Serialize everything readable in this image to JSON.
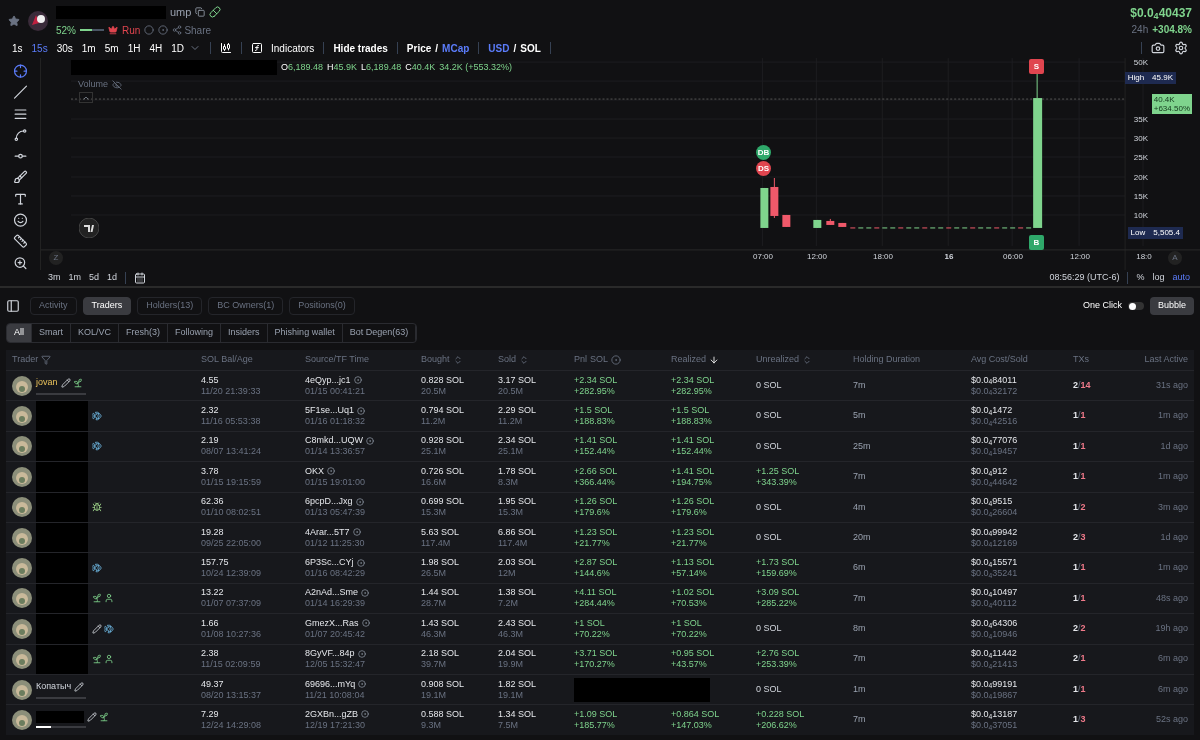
{
  "header": {
    "name_suffix": "ump",
    "progress": {
      "label": "52%",
      "level": 0.52
    },
    "run_label": "Run",
    "share_label": "Share",
    "price": "$0.0$_{4}$40437",
    "change_label": "24h",
    "change": "+304.8%"
  },
  "toolbar": {
    "timeframes": [
      {
        "label": "1s",
        "selected": false
      },
      {
        "label": "15s",
        "selected": true
      },
      {
        "label": "30s",
        "selected": false
      },
      {
        "label": "1m",
        "selected": false
      },
      {
        "label": "5m",
        "selected": false
      },
      {
        "label": "1H",
        "selected": false
      },
      {
        "label": "4H",
        "selected": false
      },
      {
        "label": "1D",
        "selected": false
      }
    ],
    "indicators": "Indicators",
    "hide_trades": "Hide trades",
    "metric": {
      "separator": "/",
      "options": [
        {
          "label": "Price",
          "selected": false
        },
        {
          "label": "MCap",
          "selected": true
        }
      ]
    },
    "currency": {
      "separator": "/",
      "options": [
        {
          "label": "USD",
          "selected": true
        },
        {
          "label": "SOL",
          "selected": false
        }
      ]
    }
  },
  "chart": {
    "ohlc": [
      {
        "label": "O",
        "value": "6,189.48"
      },
      {
        "label": "H",
        "value": "45.9K"
      },
      {
        "label": "L",
        "value": "6,189.48"
      },
      {
        "label": "C",
        "value": "40.4K"
      }
    ],
    "change": "34.2K (+553.32%)",
    "volume_label": "Volume",
    "y_labels": [
      "50K",
      "35K",
      "30K",
      "25K",
      "20K",
      "15K",
      "10K"
    ],
    "high": {
      "label": "High",
      "value": "45.9K"
    },
    "last": {
      "value": "40.4K",
      "change": "+634.50%"
    },
    "low": {
      "label": "Low",
      "value": "5,505.4"
    },
    "x_labels": [
      {
        "label": "07:00",
        "bold": false
      },
      {
        "label": "12:00",
        "bold": false
      },
      {
        "label": "18:00",
        "bold": false
      },
      {
        "label": "16",
        "bold": true
      },
      {
        "label": "06:00",
        "bold": false
      },
      {
        "label": "12:00",
        "bold": false
      },
      {
        "label": "18:0",
        "bold": false
      }
    ],
    "markers": [
      {
        "label": "DB",
        "color": "#2fa86a"
      },
      {
        "label": "DS",
        "color": "#e0454f"
      },
      {
        "label": "S",
        "color": "#e0454f"
      },
      {
        "label": "B",
        "color": "#2fa86a"
      }
    ],
    "left_scale": "Z",
    "right_scale": "A",
    "ranges": [
      "3m",
      "1m",
      "5d",
      "1d"
    ],
    "clock": "08:56:29 (UTC-6)",
    "scale_options": [
      {
        "label": "%",
        "selected": false
      },
      {
        "label": "log",
        "selected": false
      },
      {
        "label": "auto",
        "selected": true
      }
    ]
  },
  "tabs": [
    {
      "label": "Activity",
      "selected": false
    },
    {
      "label": "Traders",
      "selected": true
    },
    {
      "label": "Holders(13)",
      "selected": false
    },
    {
      "label": "BC Owners(1)",
      "selected": false
    },
    {
      "label": "Positions(0)",
      "selected": false
    }
  ],
  "one_click": {
    "label": "One Click",
    "on": false
  },
  "bubble": "Bubble",
  "filters": [
    {
      "label": "All",
      "selected": true
    },
    {
      "label": "Smart",
      "selected": false
    },
    {
      "label": "KOL/VC",
      "selected": false
    },
    {
      "label": "Fresh(3)",
      "selected": false
    },
    {
      "label": "Following",
      "selected": false
    },
    {
      "label": "Insiders",
      "selected": false
    },
    {
      "label": "Phishing wallet",
      "selected": false
    },
    {
      "label": "Bot Degen(63)",
      "selected": false
    }
  ],
  "columns": [
    {
      "label": "Trader",
      "kind": "filter"
    },
    {
      "label": "SOL Bal/Age",
      "kind": "plain"
    },
    {
      "label": "Source/TF Time",
      "kind": "plain"
    },
    {
      "label": "Bought",
      "kind": "sort"
    },
    {
      "label": "Sold",
      "kind": "sort"
    },
    {
      "label": "Pnl",
      "kind": "toggle",
      "unit": "SOL"
    },
    {
      "label": "Realized",
      "kind": "sorted"
    },
    {
      "label": "Unrealized",
      "kind": "sort"
    },
    {
      "label": "Holding Duration",
      "kind": "plain"
    },
    {
      "label": "Avg Cost/Sold",
      "kind": "plain"
    },
    {
      "label": "TXs",
      "kind": "plain"
    },
    {
      "label": "Last Active",
      "kind": "plain"
    }
  ],
  "rows": [
    {
      "kind": "named",
      "name": "jovan",
      "level": 0,
      "badges": [
        {
          "kind": "edit"
        },
        {
          "kind": "sprout"
        }
      ],
      "bal": "4.55",
      "age": "11/20 21:39:33",
      "source": "4eQyp...jc1",
      "tf_time": "01/15 00:41:21",
      "bought": "0.828 SOL",
      "bought_amt": "20.5M",
      "sold": "3.17 SOL",
      "sold_amt": "20.5M",
      "pnl": {
        "kind": "value",
        "sol": "+2.34 SOL",
        "pct": "+282.95%"
      },
      "realized": "+2.34 SOL",
      "realized_pct": "+282.95%",
      "unrealized": {
        "sol": "0 SOL"
      },
      "duration": "7m",
      "avg_cost": "$0.0$_{4}$84011",
      "avg_sold": "$0.0$_{4}$32172",
      "buys": "2",
      "sep": "/",
      "sells": "14",
      "last": "31s ago"
    },
    {
      "kind": "redacted",
      "badges": [
        {
          "kind": "fish"
        }
      ],
      "bal": "2.32",
      "age": "11/16 05:53:38",
      "source": "5F1se...Uq1",
      "tf_time": "01/16 01:18:32",
      "bought": "0.794 SOL",
      "bought_amt": "11.2M",
      "sold": "2.29 SOL",
      "sold_amt": "11.2M",
      "pnl": {
        "kind": "value",
        "sol": "+1.5 SOL",
        "pct": "+188.83%"
      },
      "realized": "+1.5 SOL",
      "realized_pct": "+188.83%",
      "unrealized": {
        "sol": "0 SOL"
      },
      "duration": "5m",
      "avg_cost": "$0.0$_{4}$1472",
      "avg_sold": "$0.0$_{4}$42516",
      "buys": "1",
      "sep": "/",
      "sells": "1",
      "last": "1m ago"
    },
    {
      "kind": "redacted",
      "badges": [
        {
          "kind": "fish"
        }
      ],
      "bal": "2.19",
      "age": "08/07 13:41:24",
      "source": "C8mkd...UQW",
      "tf_time": "01/14 13:36:57",
      "bought": "0.928 SOL",
      "bought_amt": "25.1M",
      "sold": "2.34 SOL",
      "sold_amt": "25.1M",
      "pnl": {
        "kind": "value",
        "sol": "+1.41 SOL",
        "pct": "+152.44%"
      },
      "realized": "+1.41 SOL",
      "realized_pct": "+152.44%",
      "unrealized": {
        "sol": "0 SOL"
      },
      "duration": "25m",
      "avg_cost": "$0.0$_{4}$77076",
      "avg_sold": "$0.0$_{4}$19457",
      "buys": "1",
      "sep": "/",
      "sells": "1",
      "last": "1d ago"
    },
    {
      "kind": "redacted",
      "badges": [],
      "bal": "3.78",
      "age": "01/15 19:15:59",
      "source": "OKX",
      "tf_time": "01/15 19:01:00",
      "bought": "0.726 SOL",
      "bought_amt": "16.6M",
      "sold": "1.78 SOL",
      "sold_amt": "8.3M",
      "pnl": {
        "kind": "value",
        "sol": "+2.66 SOL",
        "pct": "+366.44%"
      },
      "realized": "+1.41 SOL",
      "realized_pct": "+194.75%",
      "unrealized": {
        "sol": "+1.25 SOL",
        "pct": "+343.39%"
      },
      "duration": "7m",
      "avg_cost": "$0.0$_{4}$912",
      "avg_sold": "$0.0$_{4}$44642",
      "buys": "1",
      "sep": "/",
      "sells": "1",
      "last": "1m ago"
    },
    {
      "kind": "redacted",
      "badges": [
        {
          "kind": "bug"
        }
      ],
      "bal": "62.36",
      "age": "01/10 08:02:51",
      "source": "6pcpD...Jxg",
      "tf_time": "01/13 05:47:39",
      "bought": "0.699 SOL",
      "bought_amt": "15.3M",
      "sold": "1.95 SOL",
      "sold_amt": "15.3M",
      "pnl": {
        "kind": "value",
        "sol": "+1.26 SOL",
        "pct": "+179.6%"
      },
      "realized": "+1.26 SOL",
      "realized_pct": "+179.6%",
      "unrealized": {
        "sol": "0 SOL"
      },
      "duration": "4m",
      "avg_cost": "$0.0$_{4}$9515",
      "avg_sold": "$0.0$_{4}$26604",
      "buys": "1",
      "sep": "/",
      "sells": "2",
      "last": "3m ago"
    },
    {
      "kind": "redacted",
      "badges": [],
      "bal": "19.28",
      "age": "09/25 22:05:00",
      "source": "4Arar...5T7",
      "tf_time": "01/12 11:25:30",
      "bought": "5.63 SOL",
      "bought_amt": "117.4M",
      "sold": "6.86 SOL",
      "sold_amt": "117.4M",
      "pnl": {
        "kind": "value",
        "sol": "+1.23 SOL",
        "pct": "+21.77%"
      },
      "realized": "+1.23 SOL",
      "realized_pct": "+21.77%",
      "unrealized": {
        "sol": "0 SOL"
      },
      "duration": "20m",
      "avg_cost": "$0.0$_{4}$99942",
      "avg_sold": "$0.0$_{4}$12169",
      "buys": "2",
      "sep": "/",
      "sells": "3",
      "last": "1d ago"
    },
    {
      "kind": "redacted",
      "badges": [
        {
          "kind": "fish"
        }
      ],
      "bal": "157.75",
      "age": "10/24 12:39:09",
      "source": "6P3Sc...CYj",
      "tf_time": "01/16 08:42:29",
      "bought": "1.98 SOL",
      "bought_amt": "26.5M",
      "sold": "2.03 SOL",
      "sold_amt": "12M",
      "pnl": {
        "kind": "value",
        "sol": "+2.87 SOL",
        "pct": "+144.6%"
      },
      "realized": "+1.13 SOL",
      "realized_pct": "+57.14%",
      "unrealized": {
        "sol": "+1.73 SOL",
        "pct": "+159.69%"
      },
      "duration": "6m",
      "avg_cost": "$0.0$_{4}$15571",
      "avg_sold": "$0.0$_{4}$35241",
      "buys": "1",
      "sep": "/",
      "sells": "1",
      "last": "1m ago"
    },
    {
      "kind": "redacted",
      "badges": [
        {
          "kind": "sprout"
        },
        {
          "kind": "user"
        }
      ],
      "bal": "13.22",
      "age": "01/07 07:37:09",
      "source": "A2nAd...Sme",
      "tf_time": "01/14 16:29:39",
      "bought": "1.44 SOL",
      "bought_amt": "28.7M",
      "sold": "1.38 SOL",
      "sold_amt": "7.2M",
      "pnl": {
        "kind": "value",
        "sol": "+4.11 SOL",
        "pct": "+284.44%"
      },
      "realized": "+1.02 SOL",
      "realized_pct": "+70.53%",
      "unrealized": {
        "sol": "+3.09 SOL",
        "pct": "+285.22%"
      },
      "duration": "7m",
      "avg_cost": "$0.0$_{4}$10497",
      "avg_sold": "$0.0$_{4}$40112",
      "buys": "1",
      "sep": "/",
      "sells": "1",
      "last": "48s ago"
    },
    {
      "kind": "redacted",
      "badges": [
        {
          "kind": "edit"
        },
        {
          "kind": "fish"
        }
      ],
      "bal": "1.66",
      "age": "01/08 10:27:36",
      "source": "GmezX...Ras",
      "tf_time": "01/07 20:45:42",
      "bought": "1.43 SOL",
      "bought_amt": "46.3M",
      "sold": "2.43 SOL",
      "sold_amt": "46.3M",
      "pnl": {
        "kind": "value",
        "sol": "+1 SOL",
        "pct": "+70.22%"
      },
      "realized": "+1 SOL",
      "realized_pct": "+70.22%",
      "unrealized": {
        "sol": "0 SOL"
      },
      "duration": "8m",
      "avg_cost": "$0.0$_{4}$64306",
      "avg_sold": "$0.0$_{4}$10946",
      "buys": "2",
      "sep": "/",
      "sells": "2",
      "last": "19h ago"
    },
    {
      "kind": "redacted",
      "badges": [
        {
          "kind": "sprout"
        },
        {
          "kind": "user"
        }
      ],
      "bal": "2.38",
      "age": "11/15 02:09:59",
      "source": "8GyVF...84p",
      "tf_time": "12/05 15:32:47",
      "bought": "2.18 SOL",
      "bought_amt": "39.7M",
      "sold": "2.04 SOL",
      "sold_amt": "19.9M",
      "pnl": {
        "kind": "value",
        "sol": "+3.71 SOL",
        "pct": "+170.27%"
      },
      "realized": "+0.95 SOL",
      "realized_pct": "+43.57%",
      "unrealized": {
        "sol": "+2.76 SOL",
        "pct": "+253.39%"
      },
      "duration": "7m",
      "avg_cost": "$0.0$_{4}$11442",
      "avg_sold": "$0.0$_{4}$21413",
      "buys": "2",
      "sep": "/",
      "sells": "1",
      "last": "6m ago"
    },
    {
      "kind": "named",
      "name": "Копатыч",
      "level": 0,
      "badges": [
        {
          "kind": "edit"
        }
      ],
      "bal": "49.37",
      "age": "08/20 13:15:37",
      "source": "69696...mYq",
      "tf_time": "11/21 10:08:04",
      "bought": "0.908 SOL",
      "bought_amt": "19.1M",
      "sold": "1.82 SOL",
      "sold_amt": "19.1M",
      "pnl": {
        "kind": "redacted"
      },
      "unrealized": {
        "sol": "0 SOL"
      },
      "duration": "1m",
      "avg_cost": "$0.0$_{4}$99191",
      "avg_sold": "$0.0$_{4}$19867",
      "buys": "1",
      "sep": "/",
      "sells": "1",
      "last": "6m ago"
    },
    {
      "kind": "redacted_short",
      "level": 0.3,
      "badges": [
        {
          "kind": "edit"
        },
        {
          "kind": "sprout"
        }
      ],
      "bal": "7.29",
      "age": "12/24 14:29:08",
      "source": "2GXBn...gZB",
      "tf_time": "12/19 17:21:30",
      "bought": "0.588 SOL",
      "bought_amt": "9.3M",
      "sold": "1.34 SOL",
      "sold_amt": "7.5M",
      "pnl": {
        "kind": "value",
        "sol": "+1.09 SOL",
        "pct": "+185.77%"
      },
      "realized": "+0.864 SOL",
      "realized_pct": "+147.03%",
      "unrealized": {
        "sol": "+0.228 SOL",
        "pct": "+206.62%"
      },
      "duration": "7m",
      "avg_cost": "$0.0$_{4}$13187",
      "avg_sold": "$0.0$_{4}$37051",
      "buys": "1",
      "sep": "/",
      "sells": "3",
      "last": "52s ago"
    }
  ]
}
